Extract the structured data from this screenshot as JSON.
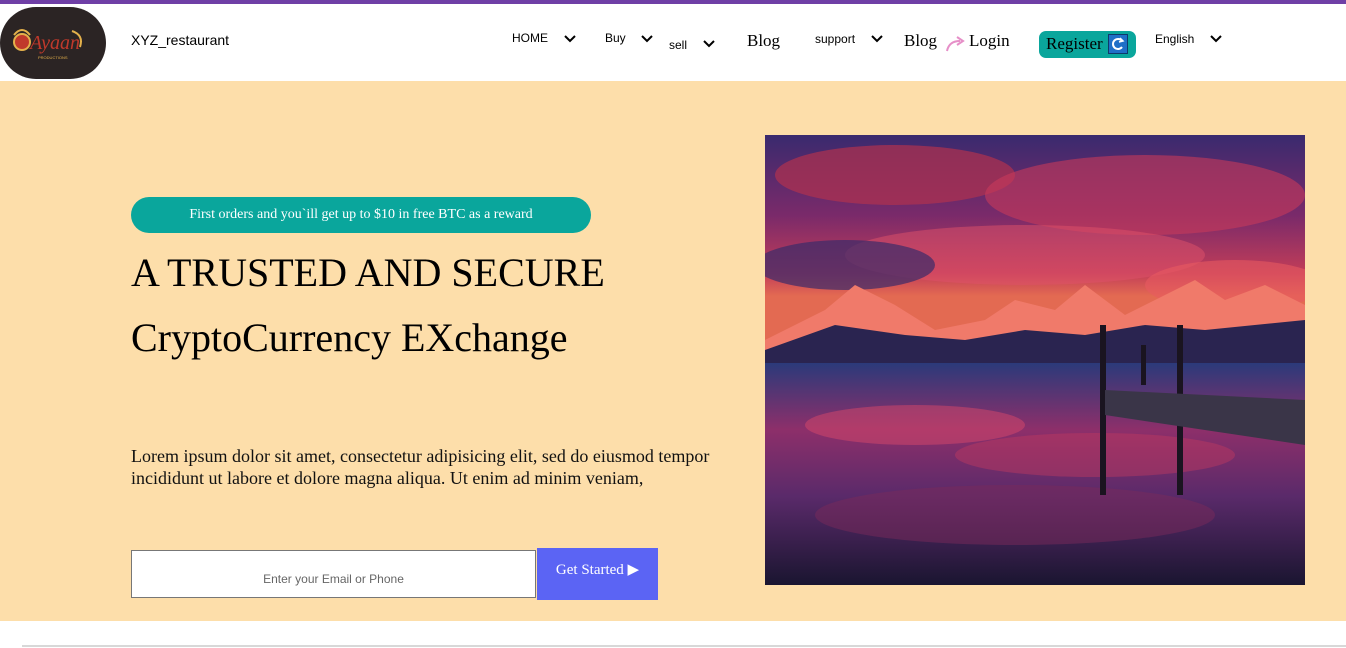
{
  "brand": {
    "logo_text": "Ayaan",
    "logo_subtext": "PRODUCTIONS",
    "site_name": "XYZ_restaurant"
  },
  "nav": {
    "home": "HOME",
    "buy": "Buy",
    "sell": "sell",
    "blog1": "Blog",
    "support": "support",
    "blog2": "Blog",
    "login": "Login",
    "register": "Register",
    "language": "English"
  },
  "hero": {
    "promo": "First orders and you`ill get up to $10 in free BTC as a reward",
    "headline_line1": "A TRUSTED AND SECURE",
    "headline_line2": "CryptoCurrency EXchange",
    "description": "Lorem ipsum dolor sit amet, consectetur adipisicing elit, sed do eiusmod tempor incididunt ut labore et dolore magna aliqua. Ut enim ad minim veniam,",
    "email_placeholder": "Enter your Email or Phone",
    "cta": "Get Started ▶"
  },
  "colors": {
    "top_accent": "#6f3fa6",
    "hero_bg": "#fddeaa",
    "teal": "#0aa69c",
    "cta": "#5b64f4"
  },
  "icons": [
    "chevron-down-icon",
    "login-arrow-icon",
    "refresh-icon",
    "play-icon"
  ]
}
